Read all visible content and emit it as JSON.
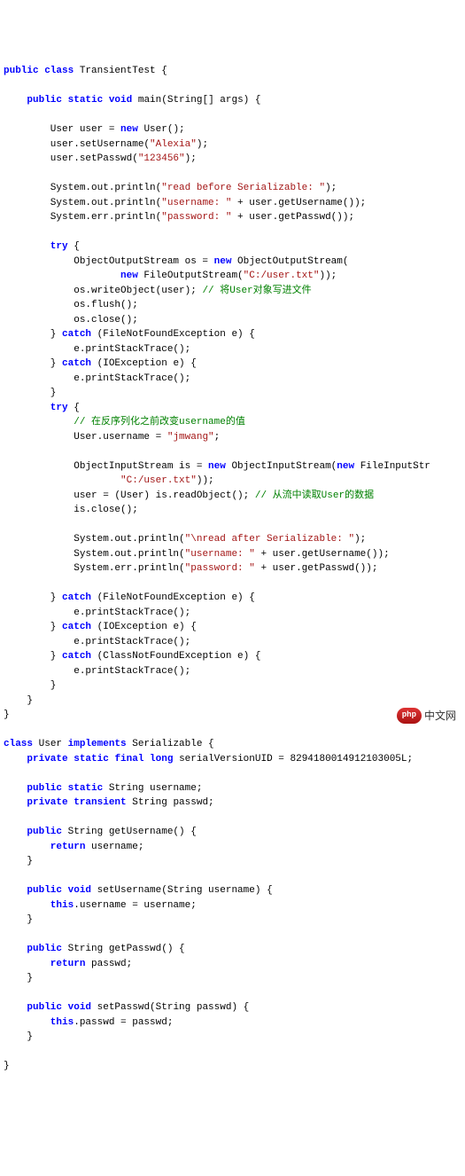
{
  "code": {
    "l01a": "public",
    "l01b": " class",
    "l01c": " TransientTest {",
    "l03a": "    public",
    "l03b": " static",
    "l03c": " void",
    "l03d": " main(String[] args) {",
    "l05a": "        User user = ",
    "l05b": "new",
    "l05c": " User();",
    "l06a": "        user.setUsername(",
    "l06b": "\"Alexia\"",
    "l06c": ");",
    "l07a": "        user.setPasswd(",
    "l07b": "\"123456\"",
    "l07c": ");",
    "l09a": "        System.out.println(",
    "l09b": "\"read before Serializable: \"",
    "l09c": ");",
    "l10a": "        System.out.println(",
    "l10b": "\"username: \"",
    "l10c": " + user.getUsername());",
    "l11a": "        System.err.println(",
    "l11b": "\"password: \"",
    "l11c": " + user.getPasswd());",
    "l13a": "        try",
    "l13b": " {",
    "l14a": "            ObjectOutputStream os = ",
    "l14b": "new",
    "l14c": " ObjectOutputStream(",
    "l15a": "                    new",
    "l15b": " FileOutputStream(",
    "l15c": "\"C:/user.txt\"",
    "l15d": "));",
    "l16a": "            os.writeObject(user); ",
    "l16b": "// 将User对象写进文件",
    "l17a": "            os.flush();",
    "l18a": "            os.close();",
    "l19a": "        } ",
    "l19b": "catch",
    "l19c": " (FileNotFoundException e) {",
    "l20a": "            e.printStackTrace();",
    "l21a": "        } ",
    "l21b": "catch",
    "l21c": " (IOException e) {",
    "l22a": "            e.printStackTrace();",
    "l23a": "        }",
    "l24a": "        try",
    "l24b": " {",
    "l25a": "            // 在反序列化之前改变username的值",
    "l26a": "            User.username = ",
    "l26b": "\"jmwang\"",
    "l26c": ";",
    "l28a": "            ObjectInputStream is = ",
    "l28b": "new",
    "l28c": " ObjectInputStream(",
    "l28d": "new",
    "l28e": " FileInputStr",
    "l29a": "                    \"C:/user.txt\"",
    "l29b": "));",
    "l30a": "            user = (User) is.readObject(); ",
    "l30b": "// 从流中读取User的数据",
    "l31a": "            is.close();",
    "l33a": "            System.out.println(",
    "l33b": "\"\\nread after Serializable: \"",
    "l33c": ");",
    "l34a": "            System.out.println(",
    "l34b": "\"username: \"",
    "l34c": " + user.getUsername());",
    "l35a": "            System.err.println(",
    "l35b": "\"password: \"",
    "l35c": " + user.getPasswd());",
    "l37a": "        } ",
    "l37b": "catch",
    "l37c": " (FileNotFoundException e) {",
    "l38a": "            e.printStackTrace();",
    "l39a": "        } ",
    "l39b": "catch",
    "l39c": " (IOException e) {",
    "l40a": "            e.printStackTrace();",
    "l41a": "        } ",
    "l41b": "catch",
    "l41c": " (ClassNotFoundException e) {",
    "l42a": "            e.printStackTrace();",
    "l43a": "        }",
    "l44a": "    }",
    "l45a": "}",
    "l47a": "class",
    "l47b": " User ",
    "l47c": "implements",
    "l47d": " Serializable {",
    "l48a": "    private",
    "l48b": " static",
    "l48c": " final",
    "l48d": " long",
    "l48e": " serialVersionUID = 8294180014912103005L;",
    "l50a": "    public",
    "l50b": " static",
    "l50c": " String username;",
    "l51a": "    private",
    "l51b": " transient",
    "l51c": " String passwd;",
    "l53a": "    public",
    "l53b": " String getUsername() {",
    "l54a": "        return",
    "l54b": " username;",
    "l55a": "    }",
    "l57a": "    public",
    "l57b": " void",
    "l57c": " setUsername(String username) {",
    "l58a": "        this",
    "l58b": ".username = username;",
    "l59a": "    }",
    "l61a": "    public",
    "l61b": " String getPasswd() {",
    "l62a": "        return",
    "l62b": " passwd;",
    "l63a": "    }",
    "l65a": "    public",
    "l65b": " void",
    "l65c": " setPasswd(String passwd) {",
    "l66a": "        this",
    "l66b": ".passwd = passwd;",
    "l67a": "    }",
    "l69a": "}"
  },
  "watermark": {
    "badge": "php",
    "text": "中文网"
  }
}
